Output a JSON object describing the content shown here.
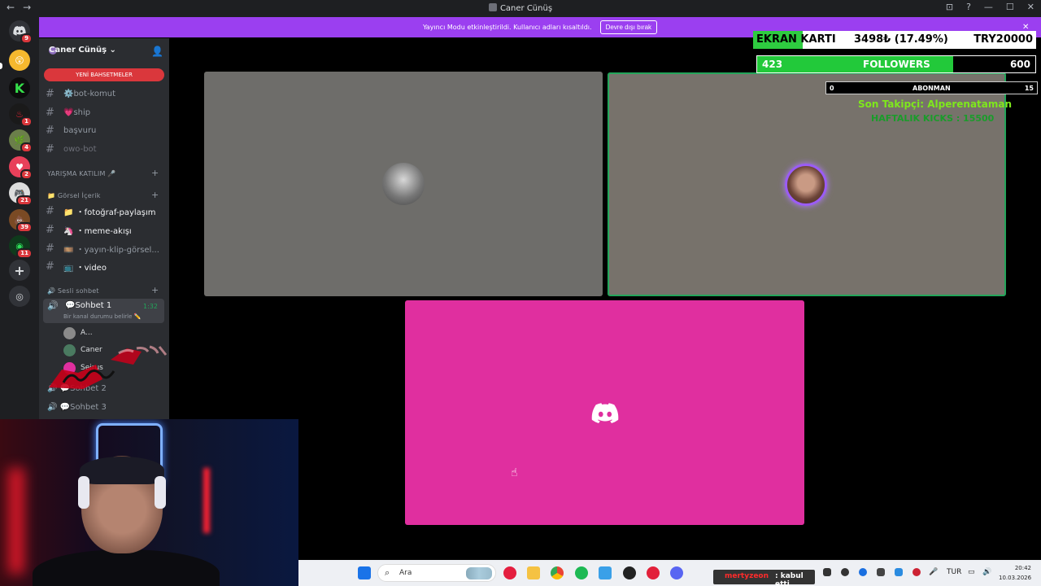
{
  "window": {
    "title": "Caner Cünüş",
    "back_glyph": "←",
    "fwd_glyph": "→",
    "controls": [
      "⊡",
      "?",
      "—",
      "☐",
      "✕"
    ]
  },
  "banner": {
    "text": "Yayıncı Modu etkinleştirildi. Kullanıcı adları kısaltıldı.",
    "button": "Devre dışı bırak",
    "close": "✕"
  },
  "rail": {
    "servers": [
      {
        "icon": "discord-home-icon",
        "badge": "9"
      },
      {
        "icon": "server-icon",
        "badge": ""
      },
      {
        "icon": "server-icon",
        "badge": ""
      },
      {
        "icon": "server-icon",
        "badge": "1"
      },
      {
        "icon": "server-icon",
        "badge": "4"
      },
      {
        "icon": "server-icon",
        "badge": "2"
      },
      {
        "icon": "server-icon",
        "badge": "21"
      },
      {
        "icon": "server-icon",
        "badge": "39"
      },
      {
        "icon": "server-icon",
        "badge": "11"
      }
    ],
    "add_glyph": "+",
    "explore_glyph": "◎"
  },
  "guild": {
    "name": "Caner Cünüş",
    "chevron": "⌄",
    "mentions_label": "YENİ BAHSETMELER"
  },
  "channels": [
    {
      "name": "⚙️bot-komut",
      "style": "normal"
    },
    {
      "name": "💗ship",
      "style": "normal"
    },
    {
      "name": "başvuru",
      "style": "normal"
    },
    {
      "name": "owo-bot",
      "style": "dim"
    }
  ],
  "category_yarisma": "YARIŞMA KATILIM 🎤",
  "category_gorsel": "📁 Görsel İçerik",
  "gorsel_channels": [
    {
      "name": "📁 ・fotoğraf-paylaşım"
    },
    {
      "name": "🦄 ・meme-akışı"
    },
    {
      "name": "🎞️ ・yayın-klip-görsel..."
    },
    {
      "name": "📺 ・video"
    }
  ],
  "category_sesli": "🔊 Sesli sohbet",
  "voice": {
    "active_name": "💬Sohbet 1",
    "time": "1:32",
    "status": "Bir kanal durumu belirle ✏️",
    "users": [
      {
        "name": "A...",
        "color": "#8a8a8a"
      },
      {
        "name": "Caner",
        "color": "#4a7a60"
      },
      {
        "name": "Seirus",
        "color": "#e02f9f"
      }
    ],
    "other": [
      {
        "name": "💬Sohbet 2"
      },
      {
        "name": "💬Sohbet 3"
      }
    ]
  },
  "overlay": {
    "ekran_label": "EKRAN KARTI",
    "ekran_value": "3498₺ (17.49%)",
    "ekran_goal": "TRY20000",
    "ekran_fraction": 0.1749,
    "followers_current": "423",
    "followers_label": "FOLLOWERS",
    "followers_goal": "600",
    "followers_fraction": 0.705,
    "abonman_current": "0",
    "abonman_label": "ABONMAN",
    "abonman_goal": "15",
    "son_takipci": "Son Takipçi: Alperenataman",
    "haftalik": "HAFTALIK KICKS : 15500"
  },
  "taskbar": {
    "search_placeholder": "Ara",
    "notif_user": "mertyzeon",
    "notif_msg": ": kabul etti",
    "lang": "TUR",
    "time": "20:42",
    "date": "10.03.2026"
  },
  "colors": {
    "banner": "#9b3ff0",
    "discord_pink": "#e02f9f",
    "speaking_green": "#23a55a",
    "overlay_green": "#22c93a"
  }
}
